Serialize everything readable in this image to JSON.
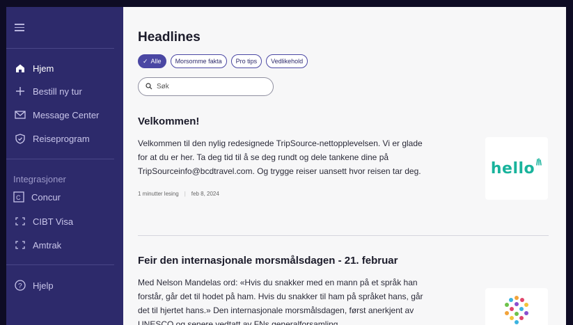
{
  "sidebar": {
    "nav": [
      {
        "label": "Hjem",
        "icon": "home-icon",
        "active": true
      },
      {
        "label": "Bestill ny tur",
        "icon": "plus-icon",
        "active": false
      },
      {
        "label": "Message Center",
        "icon": "mail-icon",
        "active": false
      },
      {
        "label": "Reiseprogram",
        "icon": "shield-icon",
        "active": false
      }
    ],
    "integrations_label": "Integrasjoner",
    "integrations": [
      {
        "label": "Concur",
        "icon": "concur-icon"
      },
      {
        "label": "CIBT Visa",
        "icon": "bracket-icon"
      },
      {
        "label": "Amtrak",
        "icon": "bracket-icon"
      }
    ],
    "help_label": "Hjelp"
  },
  "main": {
    "title": "Headlines",
    "chips": [
      {
        "label": "Alle",
        "selected": true
      },
      {
        "label": "Morsomme fakta",
        "selected": false
      },
      {
        "label": "Pro tips",
        "selected": false
      },
      {
        "label": "Vedlikehold",
        "selected": false
      }
    ],
    "search_placeholder": "Søk",
    "articles": [
      {
        "title": "Velkommen!",
        "body": "Velkommen til den nylig redesignede TripSource-nettopplevelsen. Vi er glade for at du er her. Ta deg tid til å se deg rundt og dele tankene dine på TripSourceinfo@bcdtravel.com. Og trygge reiser uansett hvor reisen tar deg.",
        "read_time": "1 minutter lesing",
        "date": "feb 8, 2024",
        "thumb_text": "hello"
      },
      {
        "title": "Feir den internasjonale morsmålsdagen - 21. februar",
        "body": "Med Nelson Mandelas ord: «Hvis du snakker med en mann på et språk han forstår, går det til hodet på ham. Hvis du snakker til ham på språket hans, går det til hjertet hans.» Den internasjonale morsmålsdagen, først anerkjent av UNESCO og senere vedtatt av FNs generalforsamling..."
      }
    ]
  },
  "colors": {
    "sidebar_bg": "#2d2a6b",
    "accent": "#4a47a3",
    "hello_green": "#19b39c"
  }
}
